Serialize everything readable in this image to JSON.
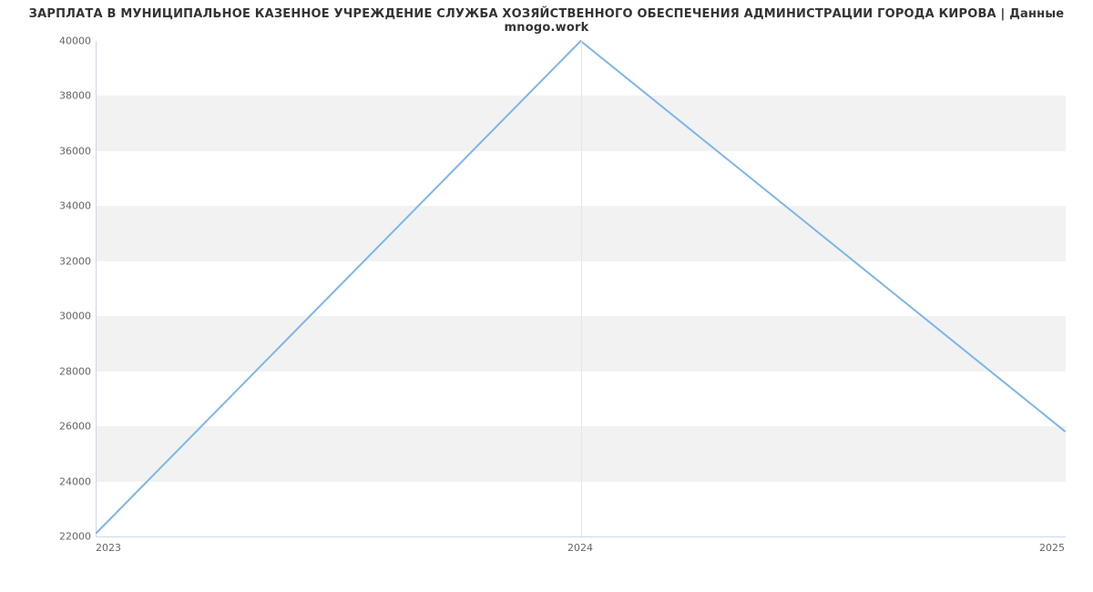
{
  "chart_data": {
    "type": "line",
    "title": "ЗАРПЛАТА В МУНИЦИПАЛЬНОЕ КАЗЕННОЕ УЧРЕЖДЕНИЕ СЛУЖБА ХОЗЯЙСТВЕННОГО ОБЕСПЕЧЕНИЯ АДМИНИСТРАЦИИ ГОРОДА КИРОВА | Данные mnogo.work",
    "x": [
      2023,
      2024,
      2025
    ],
    "values": [
      22100,
      40000,
      25800
    ],
    "xlabel": "",
    "ylabel": "",
    "x_ticks": [
      "2023",
      "2024",
      "2025"
    ],
    "y_ticks": [
      22000,
      24000,
      26000,
      28000,
      30000,
      32000,
      34000,
      36000,
      38000,
      40000
    ],
    "ylim": [
      22000,
      40000
    ],
    "xlim": [
      2023,
      2025
    ],
    "colors": {
      "line": "#7cb5ec",
      "band": "#f2f2f2"
    }
  }
}
